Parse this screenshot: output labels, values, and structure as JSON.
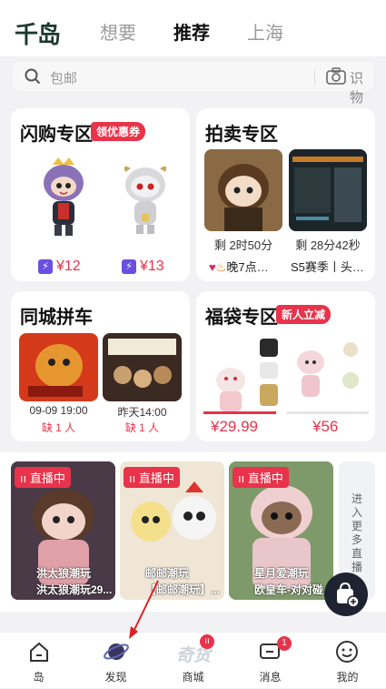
{
  "header": {
    "logo": "千岛",
    "tabs": [
      {
        "label": "想要"
      },
      {
        "label": "推荐"
      },
      {
        "label": "上海"
      }
    ]
  },
  "search": {
    "placeholder": "包邮",
    "scan_label": "识物"
  },
  "flash": {
    "title": "闪购专区",
    "badge": "领优惠券",
    "prices": [
      "¥12",
      "¥13"
    ]
  },
  "auction": {
    "title": "拍卖专区",
    "timers": [
      "剩 2时50分",
      "剩 28分42秒"
    ],
    "captions": [
      "晚7点…",
      "S5赛季丨头…"
    ]
  },
  "carpool": {
    "title": "同城拼车",
    "items": [
      {
        "time": "09-09 19:00",
        "need": "缺 1 人"
      },
      {
        "time": "昨天14:00",
        "need": "缺 1 人"
      }
    ]
  },
  "lucky": {
    "title": "福袋专区",
    "badge": "新人立减",
    "prices": [
      "¥29.99",
      "¥56"
    ]
  },
  "live": {
    "tag": "直播中",
    "cards": [
      {
        "name": "洪太狼潮玩",
        "sub": "洪太狼潮玩29..."
      },
      {
        "name": "邮邮潮玩",
        "sub": "【邮邮潮玩】..."
      },
      {
        "name": "星月爱潮玩",
        "sub": "欧皇车-对对碰"
      }
    ],
    "more": "进入更多直播"
  },
  "nav": {
    "items": [
      {
        "label": "岛"
      },
      {
        "label": "发现"
      },
      {
        "label": "商城"
      },
      {
        "label": "消息"
      },
      {
        "label": "我的"
      }
    ],
    "message_badge": "1"
  },
  "colors": {
    "accent": "#e8334a",
    "bolt": "#6b4fe0",
    "logo": "#1b3a2f"
  }
}
